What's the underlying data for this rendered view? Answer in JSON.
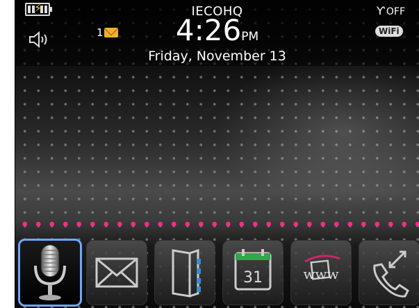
{
  "status": {
    "carrier": "IECOHQ",
    "time": "4:26",
    "ampm": "PM",
    "date": "Friday, November 13",
    "unread_messages": "1",
    "radio": "OFF",
    "wifi_label": "WiFi"
  },
  "colors": {
    "accent_pink": "#ff2a8a",
    "selection_blue": "#6fa8ff",
    "battery_bolt": "#f2c530"
  },
  "dock": {
    "apps": [
      {
        "name": "voice-dialing",
        "icon": "microphone-icon",
        "selected": true
      },
      {
        "name": "messages",
        "icon": "envelope-icon"
      },
      {
        "name": "contacts",
        "icon": "address-book-icon"
      },
      {
        "name": "calendar",
        "icon": "calendar-icon",
        "day": "31"
      },
      {
        "name": "browser",
        "icon": "browser-www-icon",
        "text": "www"
      },
      {
        "name": "phone",
        "icon": "phone-call-log-icon"
      }
    ]
  }
}
